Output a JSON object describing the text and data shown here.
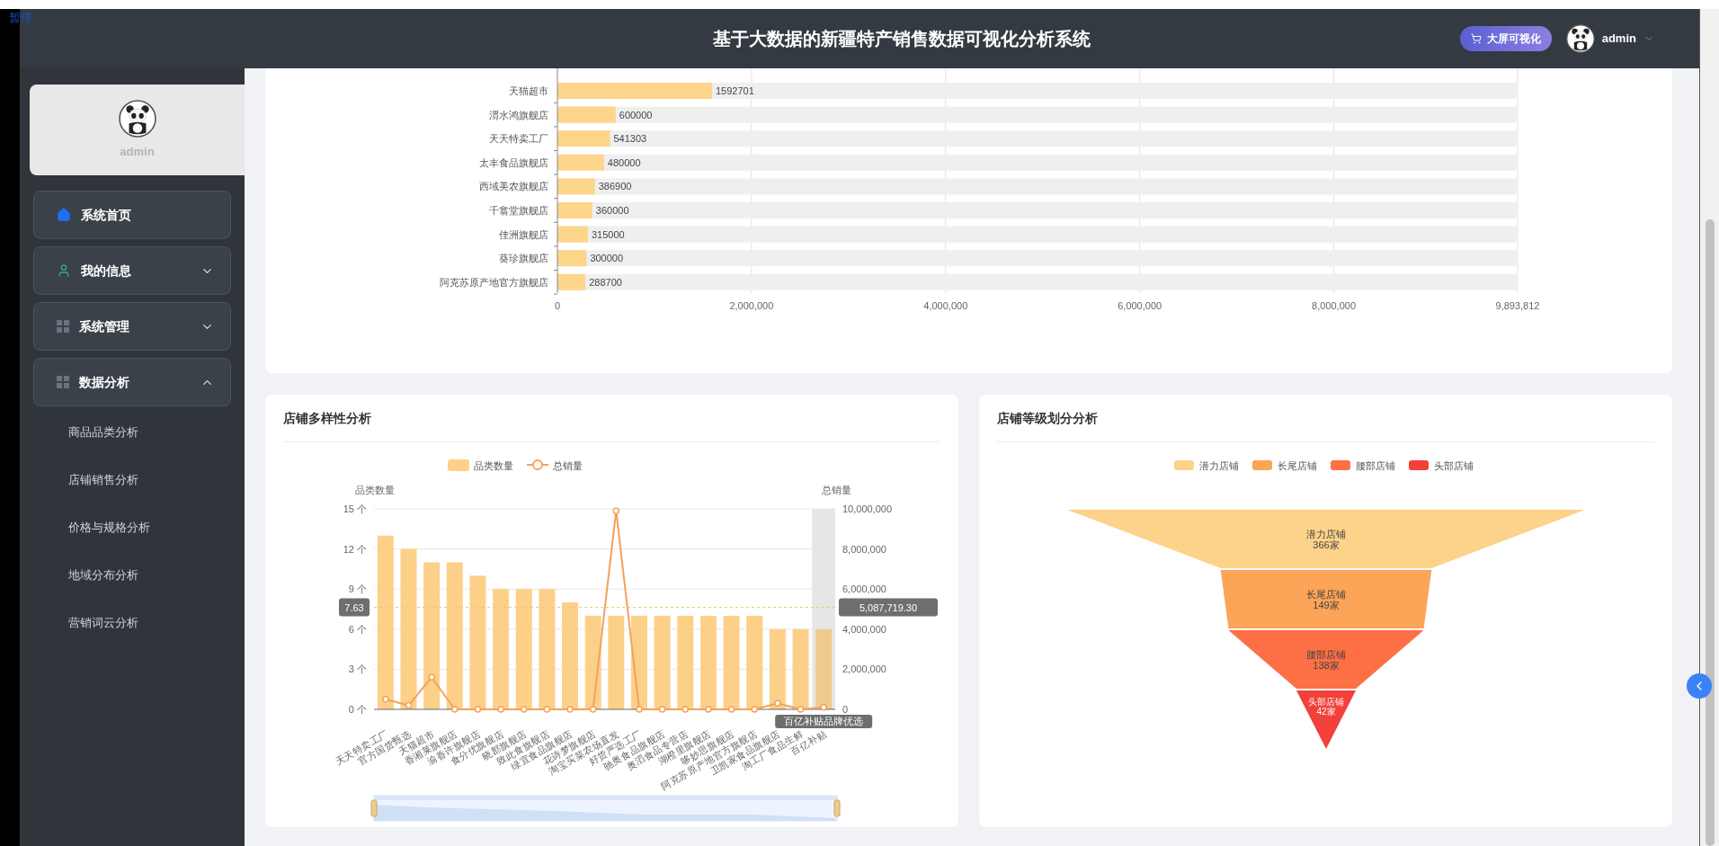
{
  "overlay_label": "暂停",
  "header": {
    "title": "基于大数据的新疆特产销售数据可视化分析系统",
    "screen_button": "大屏可视化",
    "user": "admin"
  },
  "sidebar": {
    "profile_name": "admin",
    "items": [
      {
        "label": "系统首页",
        "expandable": false
      },
      {
        "label": "我的信息",
        "expandable": true,
        "expanded": false
      },
      {
        "label": "系统管理",
        "expandable": true,
        "expanded": false
      },
      {
        "label": "数据分析",
        "expandable": true,
        "expanded": true,
        "children": [
          {
            "label": "商品品类分析"
          },
          {
            "label": "店铺销售分析"
          },
          {
            "label": "价格与规格分析"
          },
          {
            "label": "地域分布分析"
          },
          {
            "label": "营销词云分析"
          }
        ]
      }
    ]
  },
  "store_sales": {
    "chart_data": {
      "type": "bar",
      "orientation": "horizontal",
      "data_labels": true,
      "grid": true,
      "categories": [
        "天猫超市",
        "渭水鸿旗舰店",
        "天天特卖工厂",
        "太丰食品旗舰店",
        "西域美农旗舰店",
        "千翕堂旗舰店",
        "佳洲旗舰店",
        "葵珍旗舰店",
        "阿克苏原产地官方旗舰店"
      ],
      "values": [
        1592701,
        600000,
        541303,
        480000,
        386900,
        360000,
        315000,
        300000,
        288700
      ],
      "xlim": [
        0,
        9893812
      ],
      "xticks": [
        0,
        {
          "value": 2000000,
          "label": "2,000,000"
        },
        {
          "value": 4000000,
          "label": "4,000,000"
        },
        {
          "value": 6000000,
          "label": "6,000,000"
        },
        {
          "value": 8000000,
          "label": "8,000,000"
        },
        {
          "value": 9893812,
          "label": "9,893,812"
        }
      ]
    }
  },
  "diversity": {
    "title": "店铺多样性分析",
    "chart_data": {
      "type": "bar",
      "ylabel": "品类数量",
      "y2label": "总销量",
      "grid": true,
      "legend": "top",
      "categories": [
        "天天特卖工厂",
        "官方国货甄选",
        "天猫超市",
        "香湘莱旗舰店",
        "渝香许旗舰店",
        "食分优旗舰店",
        "晓郡旗舰店",
        "致此食旗舰店",
        "绿宜食品旗舰店",
        "花诗梦旗舰店",
        "淘宝买菜农场直发",
        "好货严选工厂",
        "驰奥食品旗舰店",
        "奥滔食品专营店",
        "湖橙里旗舰店",
        "哆妙思旗舰店",
        "阿克苏原产地官方旗舰店",
        "卫凯家食品旗舰店",
        "淘工厂食品生鲜",
        "百亿补贴"
      ],
      "series": [
        {
          "name": "品类数量",
          "type": "bar",
          "color": "#fdd08a",
          "values": [
            13,
            12,
            11,
            11,
            10,
            9,
            9,
            9,
            8,
            7,
            7,
            7,
            7,
            7,
            7,
            7,
            7,
            6,
            6,
            6
          ]
        },
        {
          "name": "总销量",
          "type": "line",
          "axis": "y2",
          "marker": "circle",
          "color": "#f3a25b",
          "values": [
            500000,
            200000,
            1600000,
            0,
            0,
            0,
            0,
            0,
            0,
            0,
            9900000,
            0,
            0,
            0,
            0,
            0,
            0,
            300000,
            0,
            100000
          ]
        }
      ],
      "ylim": [
        0,
        15
      ],
      "y2lim": [
        0,
        10000000
      ],
      "yticks": [
        {
          "value": 0,
          "label": "0 个"
        },
        {
          "value": 3,
          "label": "3 个"
        },
        {
          "value": 6,
          "label": "6 个"
        },
        {
          "value": 9,
          "label": "9 个"
        },
        {
          "value": 12,
          "label": "12 个"
        },
        {
          "value": 15,
          "label": "15 个"
        }
      ],
      "y2ticks": [
        0,
        {
          "value": 2000000,
          "label": "2,000,000"
        },
        {
          "value": 4000000,
          "label": "4,000,000"
        },
        {
          "value": 6000000,
          "label": "6,000,000"
        },
        {
          "value": 8000000,
          "label": "8,000,000"
        },
        {
          "value": 10000000,
          "label": "10,000,000"
        }
      ],
      "ref_lines": [
        {
          "axis": "y",
          "value": 7.63,
          "label": "7.63"
        }
      ],
      "annotations": [
        "百亿补贴品牌优选",
        "5,087,719.30"
      ]
    }
  },
  "tiers": {
    "title": "店铺等级划分分析",
    "chart_data": {
      "type": "other",
      "categories": [
        "潜力店铺",
        "长尾店铺",
        "腰部店铺",
        "头部店铺"
      ],
      "values": [
        366,
        149,
        138,
        42
      ],
      "value_labels": [
        "366家",
        "149家",
        "138家",
        "42家"
      ],
      "colors": [
        "#fdd28a",
        "#fca457",
        "#fd6f45",
        "#f2403a"
      ]
    }
  }
}
